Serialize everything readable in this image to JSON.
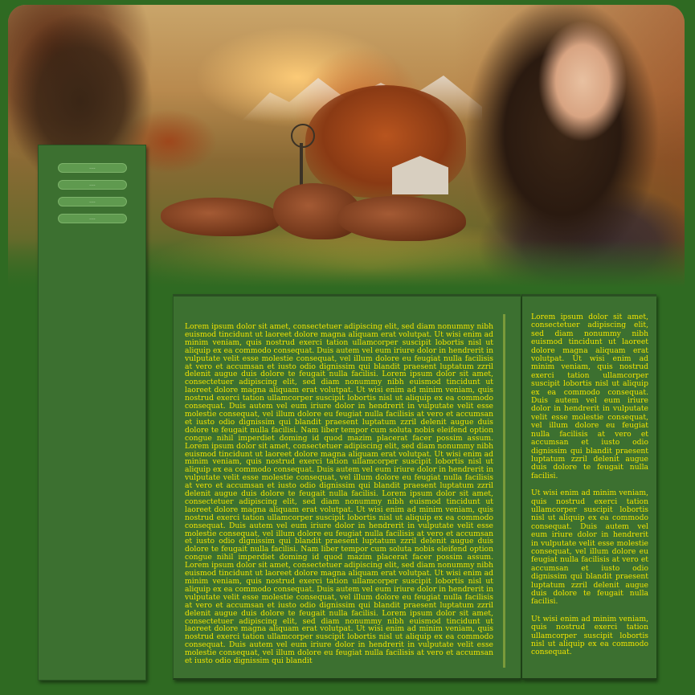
{
  "nav": {
    "items": [
      {
        "label": "....",
        "color": "#5f9a4f"
      },
      {
        "label": "....",
        "color": "#5f9a4f"
      },
      {
        "label": "....",
        "color": "#5f9a4f"
      },
      {
        "label": "....",
        "color": "#5f9a4f"
      }
    ]
  },
  "main": {
    "text": "Lorem ipsum dolor sit amet, consectetuer adipiscing elit, sed diam nonummy nibh euismod tincidunt ut laoreet dolore magna aliquam erat volutpat. Ut wisi enim ad minim veniam, quis nostrud exerci tation ullamcorper suscipit lobortis nisl ut aliquip ex ea commodo consequat. Duis autem vel eum iriure dolor in hendrerit in vulputate velit esse molestie consequat, vel illum dolore eu feugiat nulla facilisis at vero et accumsan et iusto odio dignissim qui blandit praesent luptatum zzril delenit augue duis dolore te feugait nulla facilisi. Lorem ipsum dolor sit amet, consectetuer adipiscing elit, sed diam nonummy nibh euismod tincidunt ut laoreet dolore magna aliquam erat volutpat. Ut wisi enim ad minim veniam, quis nostrud exerci tation ullamcorper suscipit lobortis nisl ut aliquip ex ea commodo consequat. Duis autem vel eum iriure dolor in hendrerit in vulputate velit esse molestie consequat, vel illum dolore eu feugiat nulla facilisis at vero et accumsan et iusto odio dignissim qui blandit praesent luptatum zzril delenit augue duis dolore te feugait nulla facilisi. Nam liber tempor cum soluta nobis eleifend option congue nihil imperdiet doming id quod mazim placerat facer possim assum. Lorem ipsum dolor sit amet, consectetuer adipiscing elit, sed diam nonummy nibh euismod tincidunt ut laoreet dolore magna aliquam erat volutpat. Ut wisi enim ad minim veniam, quis nostrud exerci tation ullamcorper suscipit lobortis nisl ut aliquip ex ea commodo consequat. Duis autem vel eum iriure dolor in hendrerit in vulputate velit esse molestie consequat, vel illum dolore eu feugiat nulla facilisis at vero et accumsan et iusto odio dignissim qui blandit praesent luptatum zzril delenit augue duis dolore te feugait nulla facilisi. Lorem ipsum dolor sit amet, consectetuer adipiscing elit, sed diam nonummy nibh euismod tincidunt ut laoreet dolore magna aliquam erat volutpat. Ut wisi enim ad minim veniam, quis nostrud exerci tation ullamcorper suscipit lobortis nisl ut aliquip ex ea commodo consequat. Duis autem vel eum iriure dolor in hendrerit in vulputate velit esse molestie consequat, vel illum dolore eu feugiat nulla facilisis at vero et accumsan et iusto odio dignissim qui blandit praesent luptatum zzril delenit augue duis dolore te feugait nulla facilisi. Nam liber tempor cum soluta nobis eleifend option congue nihil imperdiet doming id quod mazim placerat facer possim assum. Lorem ipsum dolor sit amet, consectetuer adipiscing elit, sed diam nonummy nibh euismod tincidunt ut laoreet dolore magna aliquam erat volutpat. Ut wisi enim ad minim veniam, quis nostrud exerci tation ullamcorper suscipit lobortis nisl ut aliquip ex ea commodo consequat. Duis autem vel eum iriure dolor in hendrerit in vulputate velit esse molestie consequat, vel illum dolore eu feugiat nulla facilisis at vero et accumsan et iusto odio dignissim qui blandit praesent luptatum zzril delenit augue duis dolore te feugait nulla facilisi. Lorem ipsum dolor sit amet, consectetuer adipiscing elit, sed diam nonummy nibh euismod tincidunt ut laoreet dolore magna aliquam erat volutpat. Ut wisi enim ad minim veniam, quis nostrud exerci tation ullamcorper suscipit lobortis nisl ut aliquip ex ea commodo consequat. Duis autem vel eum iriure dolor in hendrerit in vulputate velit esse molestie consequat, vel illum dolore eu feugiat nulla facilisis at vero et accumsan et iusto odio dignissim qui blandit"
  },
  "side": {
    "paragraphs": [
      "Lorem ipsum dolor sit amet, consectetuer adipiscing elit, sed diam nonummy nibh euismod tincidunt ut laoreet dolore magna aliquam erat volutpat. Ut wisi enim ad minim veniam, quis nostrud exerci tation ullamcorper suscipit lobortis nisl ut aliquip ex ea commodo consequat. Duis autem vel eum iriure dolor in hendrerit in vulputate velit esse molestie consequat, vel illum dolore eu feugiat nulla facilisis at vero et accumsan et iusto odio dignissim qui blandit praesent luptatum zzril delenit augue duis dolore te feugait nulla facilisi.",
      "Ut wisi enim ad minim veniam, quis nostrud exerci tation ullamcorper suscipit lobortis nisl ut aliquip ex ea commodo consequat. Duis autem vel eum iriure dolor in hendrerit in vulputate velit esse molestie consequat, vel illum dolore eu feugiat nulla facilisis at vero et accumsan et iusto odio dignissim qui blandit praesent luptatum zzril delenit augue duis dolore te feugait nulla facilisi.",
      "Ut wisi enim ad minim veniam, quis nostrud exerci tation ullamcorper suscipit lobortis nisl ut aliquip ex ea commodo consequat."
    ]
  },
  "colors": {
    "page_background": "#2f6a22",
    "panel_background": "#3c7030",
    "text": "#f3e400",
    "nav_button": "#5f9a4f"
  }
}
